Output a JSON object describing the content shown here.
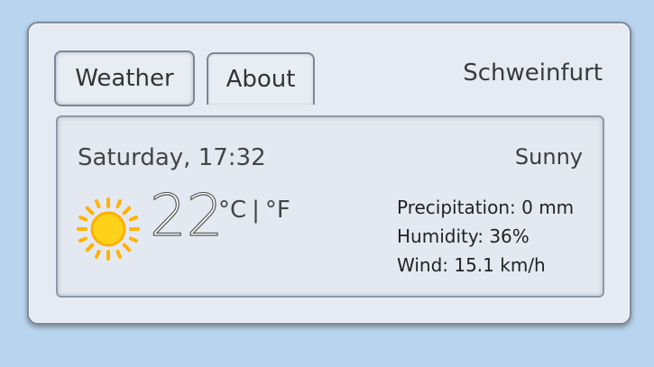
{
  "tabs": [
    {
      "label": "Weather",
      "active": true
    },
    {
      "label": "About",
      "active": false
    }
  ],
  "location": "Schweinfurt",
  "current": {
    "datetime": "Saturday, 17:32",
    "condition": "Sunny",
    "temperature": "22",
    "unit_celsius": "°C",
    "unit_separator": "|",
    "unit_fahrenheit": "°F",
    "icon": "sun-icon"
  },
  "details": {
    "precipitation": "Precipitation: 0 mm",
    "humidity": "Humidity: 36%",
    "wind": "Wind: 15.1 km/h"
  },
  "colors": {
    "background": "#b9d4ee",
    "panel": "#e6ebf3",
    "sun": "#ffd21a",
    "sun_rays": "#ffb300"
  }
}
